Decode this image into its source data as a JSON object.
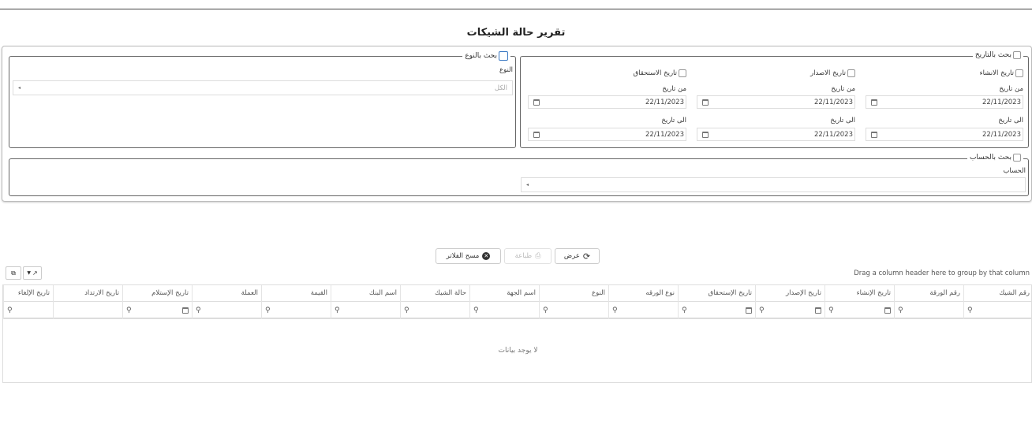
{
  "page": {
    "title": "تقرير حالة الشيكات"
  },
  "date_search": {
    "legend": "بحث بالتاريخ",
    "columns": [
      {
        "check_label": "تاريخ الانشاء",
        "from_label": "من تاريخ",
        "from_value": "22/11/2023",
        "to_label": "الى تاريخ",
        "to_value": "22/11/2023"
      },
      {
        "check_label": "تاريخ الاصدار",
        "from_label": "من تاريخ",
        "from_value": "22/11/2023",
        "to_label": "الى تاريخ",
        "to_value": "22/11/2023"
      },
      {
        "check_label": "تاريخ الاستحقاق",
        "from_label": "من تاريخ",
        "from_value": "22/11/2023",
        "to_label": "الى تاريخ",
        "to_value": "22/11/2023"
      }
    ]
  },
  "type_search": {
    "legend": "بحث بالنوع",
    "label": "النوع",
    "placeholder": "الكل"
  },
  "account_search": {
    "legend": "بحث بالحساب",
    "label": "الحساب",
    "value": ""
  },
  "actions": {
    "show": "عرض",
    "print": "طباعة",
    "clear": "مسح الفلاتر"
  },
  "grid": {
    "group_hint": "Drag a column header here to group by that column",
    "columns": [
      "رقم الشيك",
      "رقم الورقة",
      "تاريخ الإنشاء",
      "تاريخ الإصدار",
      "تاريخ الإستحقاق",
      "نوع الورقه",
      "النوع",
      "اسم الجهة",
      "حالة الشيك",
      "اسم البنك",
      "القيمة",
      "العملة",
      "تاريخ الإستلام",
      "تاريخ الارتداد",
      "تاريخ الإلغاء"
    ],
    "empty_text": "لا يوجد بيانات"
  }
}
